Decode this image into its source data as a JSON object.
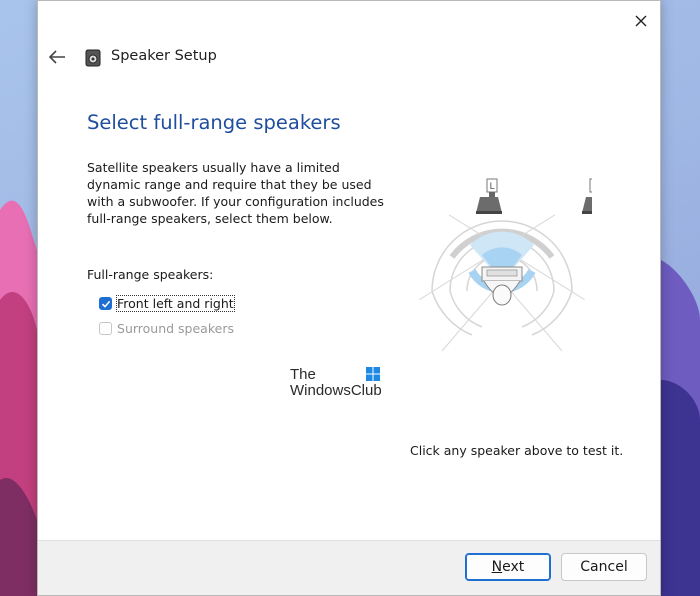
{
  "window": {
    "title": "Speaker Setup"
  },
  "page": {
    "heading": "Select full-range speakers",
    "description": "Satellite speakers usually have a limited dynamic range and require that they be used with a subwoofer.  If your configuration includes full-range speakers, select them below.",
    "group_label": "Full-range speakers:",
    "options": [
      {
        "label": "Front left and right",
        "checked": true,
        "enabled": true
      },
      {
        "label": "Surround speakers",
        "checked": false,
        "enabled": false
      }
    ],
    "hint": "Click any speaker above to test it."
  },
  "diagram": {
    "left_label": "L",
    "right_label": "R"
  },
  "watermark": {
    "line1": "The",
    "line2": "WindowsClub"
  },
  "buttons": {
    "next": "Next",
    "cancel": "Cancel"
  },
  "colors": {
    "heading": "#1f4e9e",
    "accent": "#1f6fd3"
  }
}
